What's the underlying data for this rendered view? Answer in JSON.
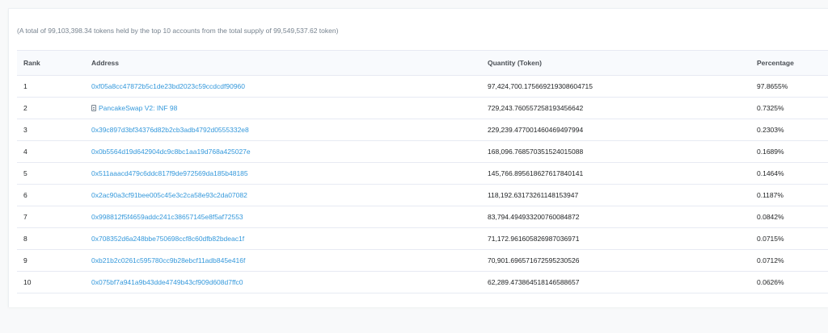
{
  "summary": "(A total of 99,103,398.34 tokens held by the top 10 accounts from the total supply of 99,549,537.62 token)",
  "columns": {
    "rank": "Rank",
    "address": "Address",
    "quantity": "Quantity (Token)",
    "percentage": "Percentage"
  },
  "rows": [
    {
      "rank": "1",
      "address": "0xf05a8cc47872b5c1de23bd2023c59ccdcdf90960",
      "is_contract": false,
      "quantity": "97,424,700.175669219308604715",
      "percentage": "97.8655%"
    },
    {
      "rank": "2",
      "address": "PancakeSwap V2: INF 98",
      "is_contract": true,
      "quantity": "729,243.760557258193456642",
      "percentage": "0.7325%"
    },
    {
      "rank": "3",
      "address": "0x39c897d3bf34376d82b2cb3adb4792d0555332e8",
      "is_contract": false,
      "quantity": "229,239.477001460469497994",
      "percentage": "0.2303%"
    },
    {
      "rank": "4",
      "address": "0x0b5564d19d642904dc9c8bc1aa19d768a425027e",
      "is_contract": false,
      "quantity": "168,096.768570351524015088",
      "percentage": "0.1689%"
    },
    {
      "rank": "5",
      "address": "0x511aaacd479c6ddc817f9de972569da185b48185",
      "is_contract": false,
      "quantity": "145,766.895618627617840141",
      "percentage": "0.1464%"
    },
    {
      "rank": "6",
      "address": "0x2ac90a3cf91bee005c45e3c2ca58e93c2da07082",
      "is_contract": false,
      "quantity": "118,192.63173261148153947",
      "percentage": "0.1187%"
    },
    {
      "rank": "7",
      "address": "0x998812f5f4659addc241c38657145e8f5af72553",
      "is_contract": false,
      "quantity": "83,794.494933200760084872",
      "percentage": "0.0842%"
    },
    {
      "rank": "8",
      "address": "0x708352d6a248bbe750698ccf8c60dfb82bdeac1f",
      "is_contract": false,
      "quantity": "71,172.961605826987036971",
      "percentage": "0.0715%"
    },
    {
      "rank": "9",
      "address": "0xb21b2c0261c595780cc9b28ebcf11adb845e416f",
      "is_contract": false,
      "quantity": "70,901.696571672595230526",
      "percentage": "0.0712%"
    },
    {
      "rank": "10",
      "address": "0x075bf7a941a9b43dde4749b43cf909d608d7ffc0",
      "is_contract": false,
      "quantity": "62,289.473864518146588657",
      "percentage": "0.0626%"
    }
  ],
  "colors": {
    "link": "#3498db",
    "text": "#1e2022",
    "muted": "#77838f",
    "header_bg": "#f8fafd",
    "border": "#e7eaf3"
  },
  "icons": {
    "contract": "contract-file-icon"
  }
}
